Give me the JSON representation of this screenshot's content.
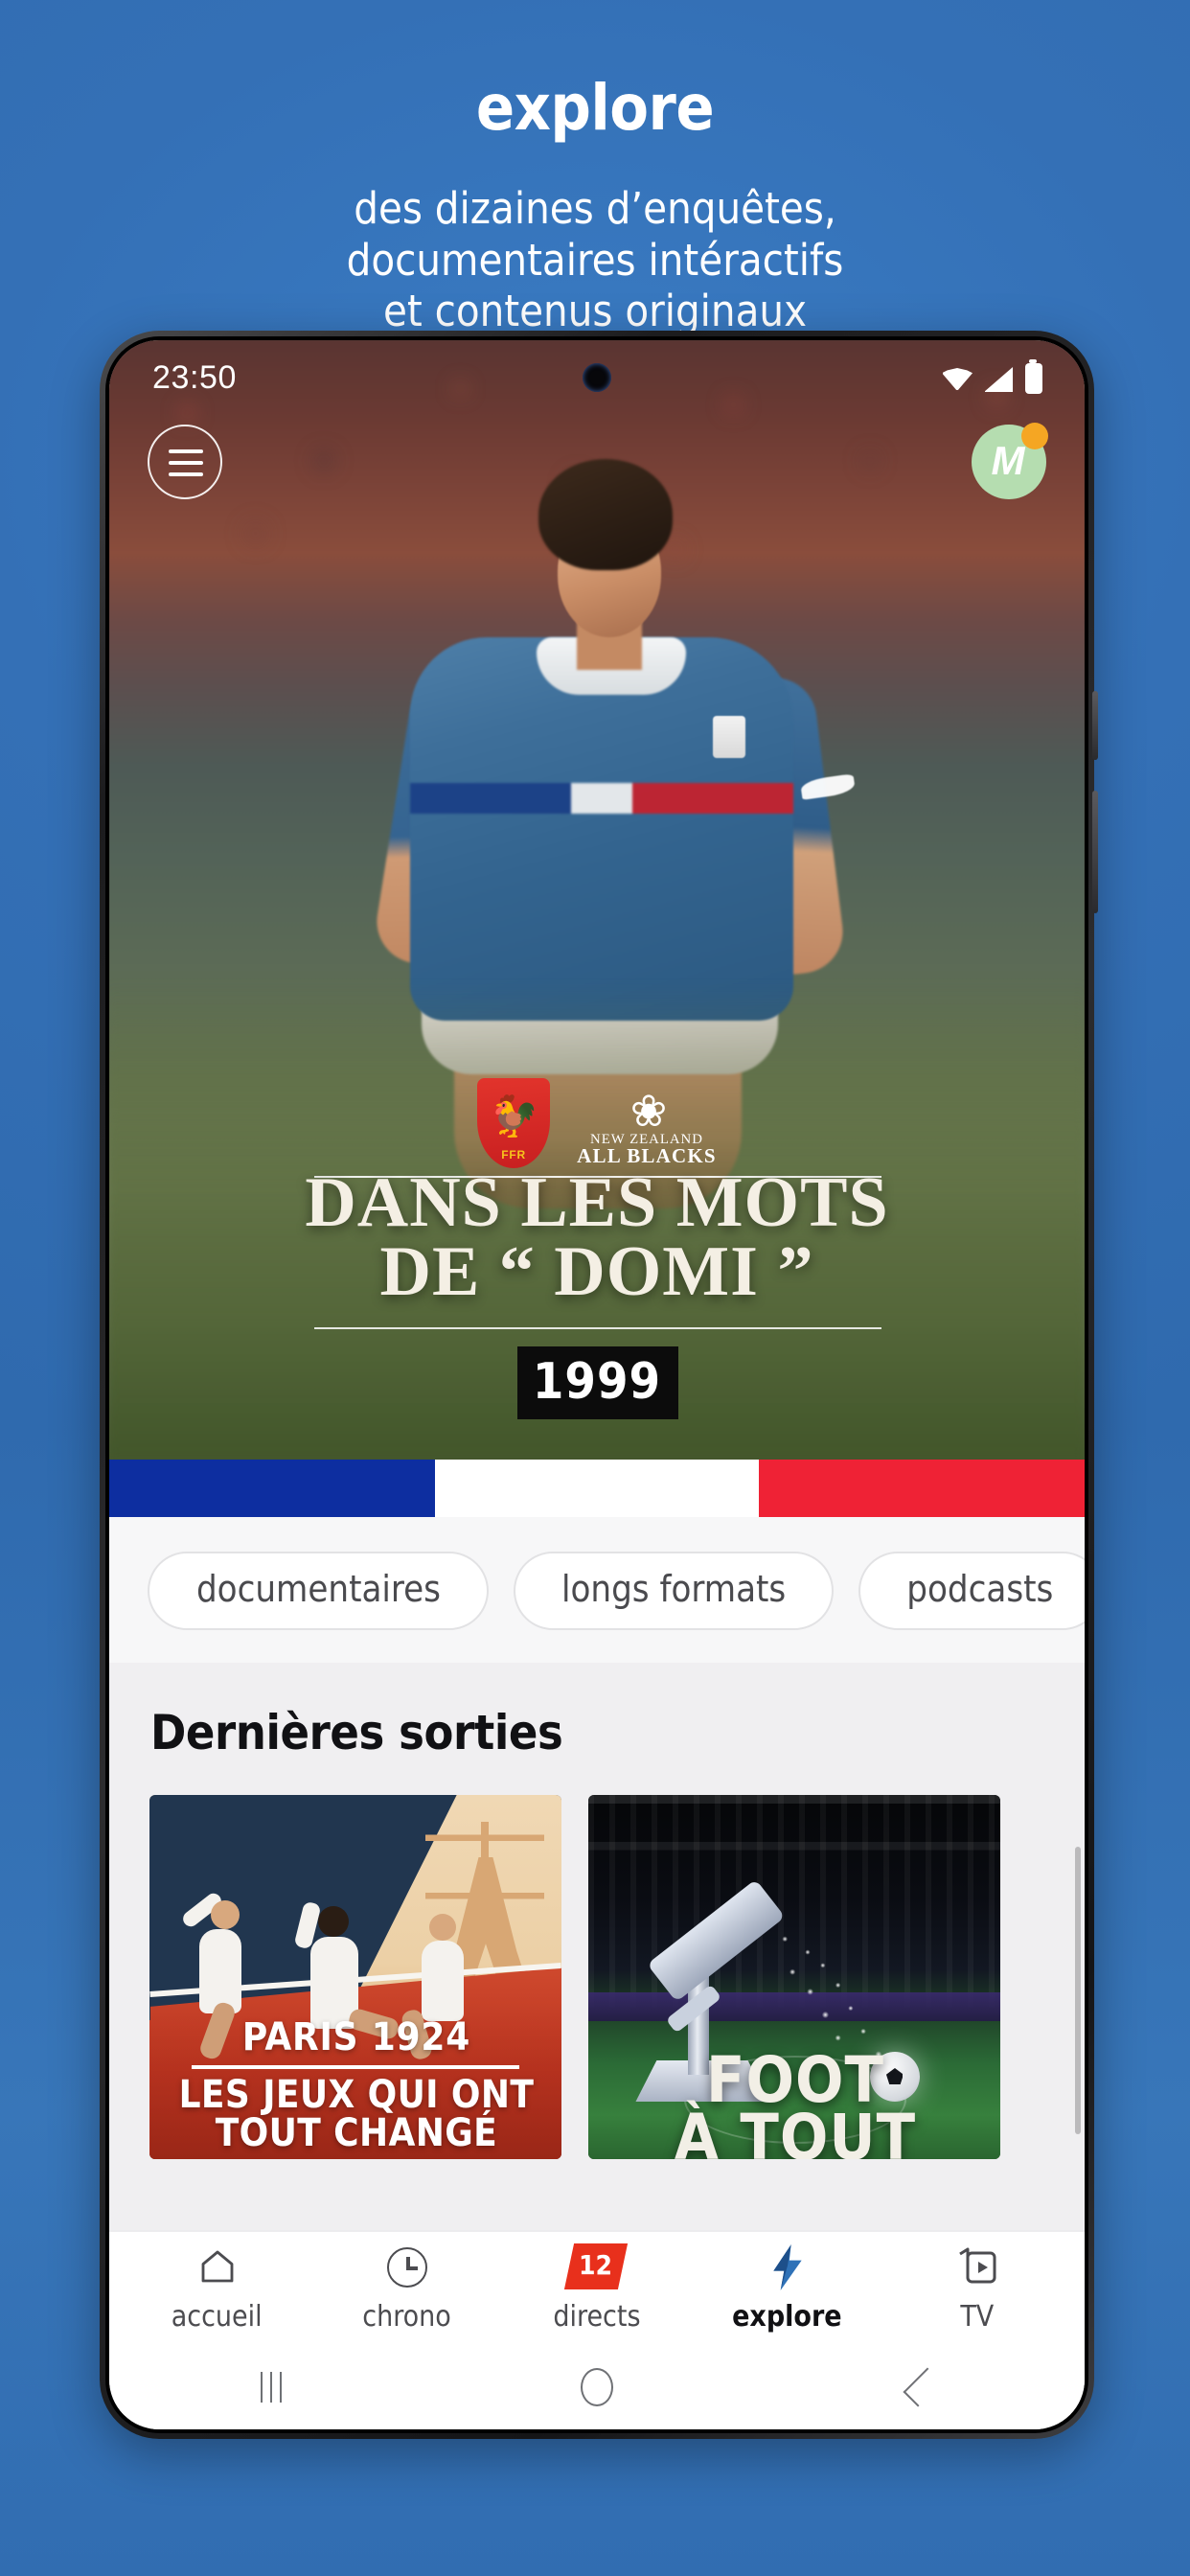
{
  "promo": {
    "title": "explore",
    "subtitle_lines": [
      "des dizaines d’enquêtes,",
      "documentaires intéractifs",
      "et contenus originaux"
    ],
    "background_color": "#3573b9",
    "text_color": "#ffffff"
  },
  "phone": {
    "status_bar": {
      "time": "23:50",
      "icons": [
        "wifi-icon",
        "cellular-signal-icon",
        "battery-icon"
      ]
    },
    "android_nav": {
      "recents_label": "recents-icon",
      "home_label": "home-icon",
      "back_label": "back-icon"
    }
  },
  "app": {
    "header": {
      "menu_icon": "hamburger-menu-icon",
      "avatar_initial": "M",
      "avatar_color": "#b5ddb0",
      "notification_dot_color": "#f5a623"
    },
    "hero": {
      "crest_left": {
        "name": "FFR",
        "glyph": "🐓",
        "shield_color": "#d42528",
        "emblem_color": "#f6c31d"
      },
      "crest_right": {
        "line1": "NEW ZEALAND",
        "line2": "ALL BLACKS",
        "fern": "❀"
      },
      "title_line1": "DANS LES MOTS",
      "title_line2": "DE “ DOMI ”",
      "year": "1999"
    },
    "tricolor": {
      "blue": "#0d2ea0",
      "white": "#ffffff",
      "red": "#ef2235"
    },
    "chips": [
      {
        "label": "documentaires"
      },
      {
        "label": "longs formats"
      },
      {
        "label": "podcasts"
      }
    ],
    "section": {
      "title": "Dernières sorties"
    },
    "cards": [
      {
        "name": "paris-1924",
        "caption_line1": "PARIS 1924",
        "caption_line2": "LES JEUX QUI ONT",
        "caption_line3": "TOUT CHANGÉ"
      },
      {
        "name": "foot-a-tout-prix",
        "caption_line1": "FOOT",
        "caption_line2": "À TOUT"
      }
    ],
    "bottom_nav": [
      {
        "label": "accueil",
        "icon": "home-icon",
        "active": false,
        "badge": null
      },
      {
        "label": "chrono",
        "icon": "clock-icon",
        "active": false,
        "badge": null
      },
      {
        "label": "directs",
        "icon": "live-icon",
        "active": false,
        "badge": "12"
      },
      {
        "label": "explore",
        "icon": "bolt-icon",
        "active": true,
        "badge": null
      },
      {
        "label": "TV",
        "icon": "tv-icon",
        "active": false,
        "badge": null
      }
    ]
  }
}
